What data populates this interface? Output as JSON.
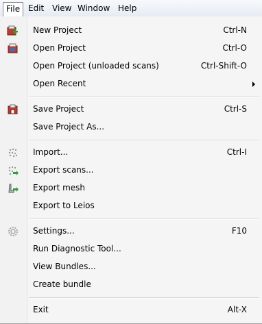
{
  "menubar": {
    "items": [
      {
        "label": "File"
      },
      {
        "label": "Edit"
      },
      {
        "label": "View"
      },
      {
        "label": "Window"
      },
      {
        "label": "Help"
      }
    ]
  },
  "menu": {
    "new_project": {
      "label": "New Project",
      "shortcut": "Ctrl-N",
      "icon": "new-project-icon"
    },
    "open_project": {
      "label": "Open Project",
      "shortcut": "Ctrl-O",
      "icon": "open-project-icon"
    },
    "open_unloaded": {
      "label": "Open Project (unloaded scans)",
      "shortcut": "Ctrl-Shift-O"
    },
    "open_recent": {
      "label": "Open Recent"
    },
    "save_project": {
      "label": "Save Project",
      "shortcut": "Ctrl-S",
      "icon": "save-project-icon"
    },
    "save_as": {
      "label": "Save Project As..."
    },
    "import": {
      "label": "Import...",
      "shortcut": "Ctrl-I",
      "icon": "import-icon"
    },
    "export_scans": {
      "label": "Export scans...",
      "icon": "export-scans-icon"
    },
    "export_mesh": {
      "label": "Export mesh",
      "icon": "export-mesh-icon"
    },
    "export_leios": {
      "label": "Export to Leios"
    },
    "settings": {
      "label": "Settings...",
      "shortcut": "F10",
      "icon": "gear-icon"
    },
    "run_diag": {
      "label": "Run Diagnostic Tool..."
    },
    "view_bundles": {
      "label": "View Bundles..."
    },
    "create_bundle": {
      "label": "Create bundle"
    },
    "exit": {
      "label": "Exit",
      "shortcut": "Alt-X"
    }
  }
}
